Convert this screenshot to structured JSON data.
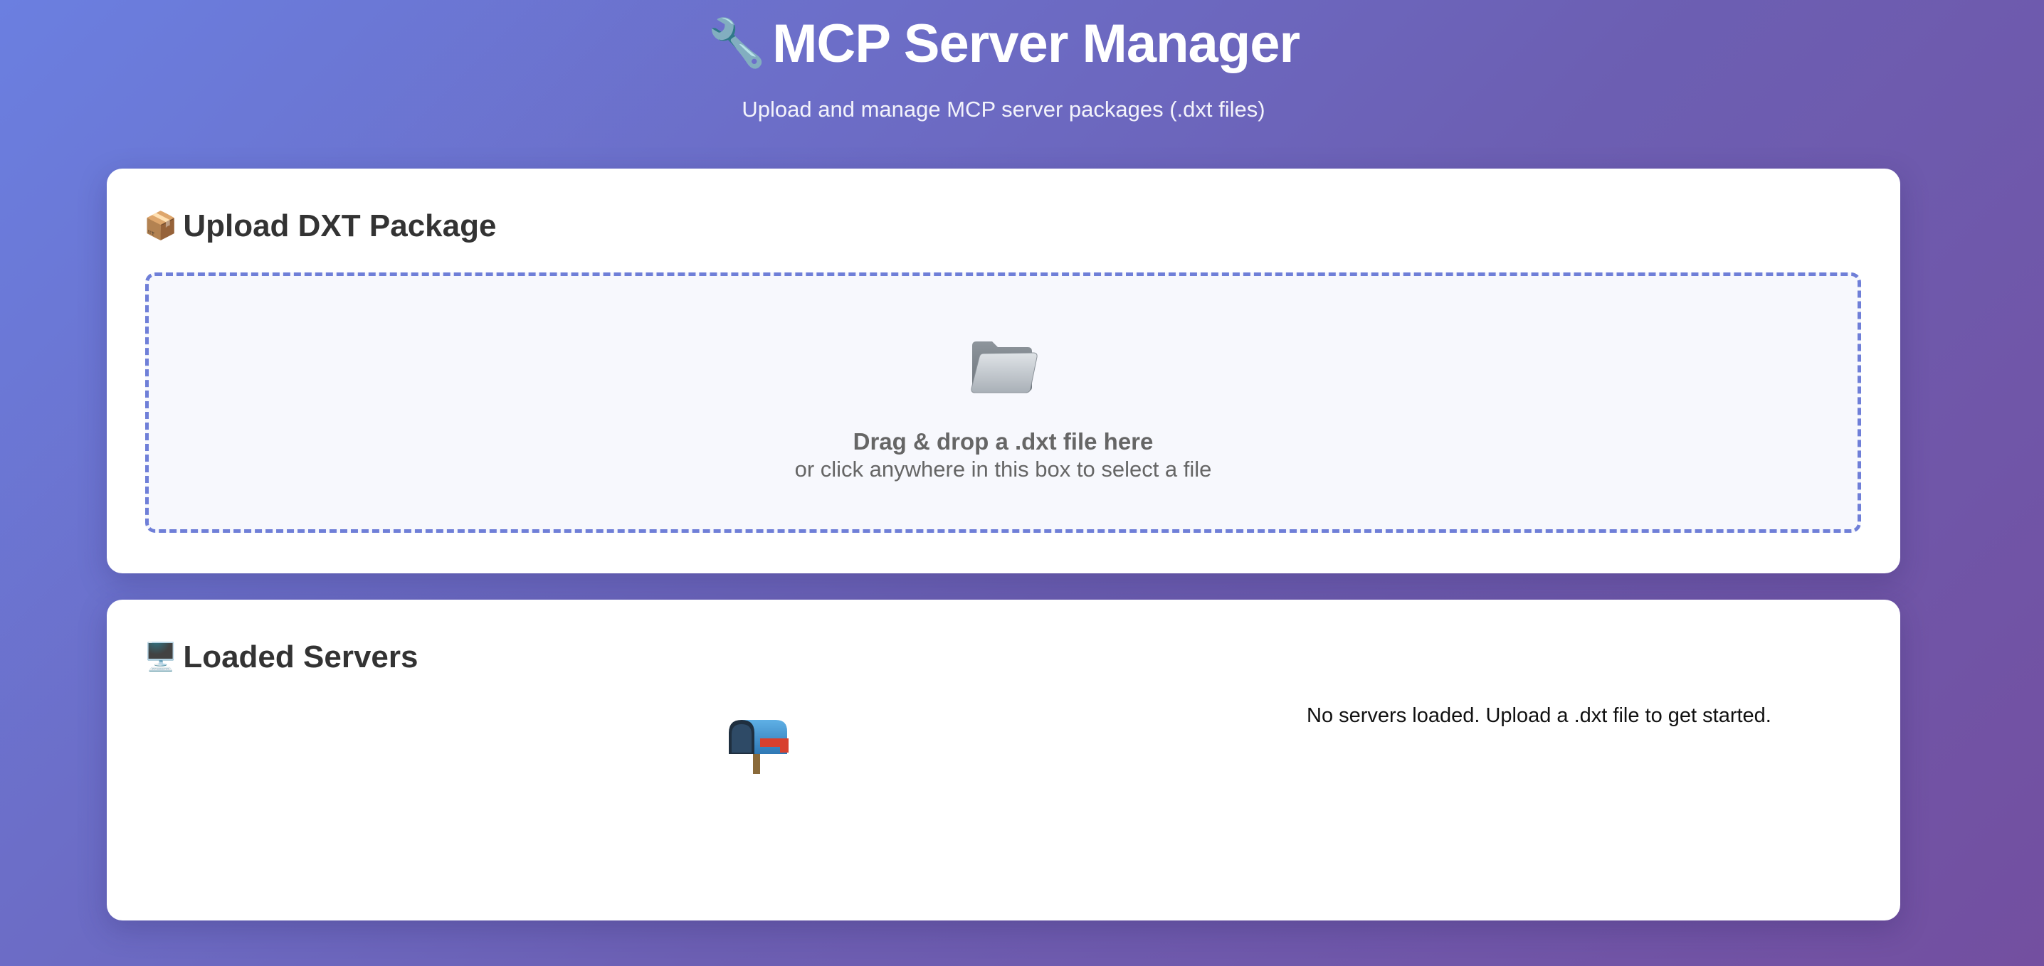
{
  "header": {
    "title_emoji": "🔧",
    "title": "MCP Server Manager",
    "subtitle": "Upload and manage MCP server packages (.dxt files)"
  },
  "upload_section": {
    "title_emoji": "📦",
    "title": "Upload DXT Package",
    "drop_zone": {
      "icon": "folder-icon",
      "primary_text": "Drag & drop a .dxt file here",
      "secondary_text": "or click anywhere in this box to select a file"
    }
  },
  "servers_section": {
    "title_emoji": "🖥️",
    "title": "Loaded Servers",
    "empty_state": {
      "icon": "mailbox-icon",
      "text": "No servers loaded. Upload a .dxt file to get started."
    }
  },
  "colors": {
    "background_start": "#6b7fe0",
    "background_end": "#734fa0",
    "accent_border": "#6f7fd8",
    "drop_zone_bg": "#f7f8fd",
    "card_bg": "#ffffff"
  }
}
